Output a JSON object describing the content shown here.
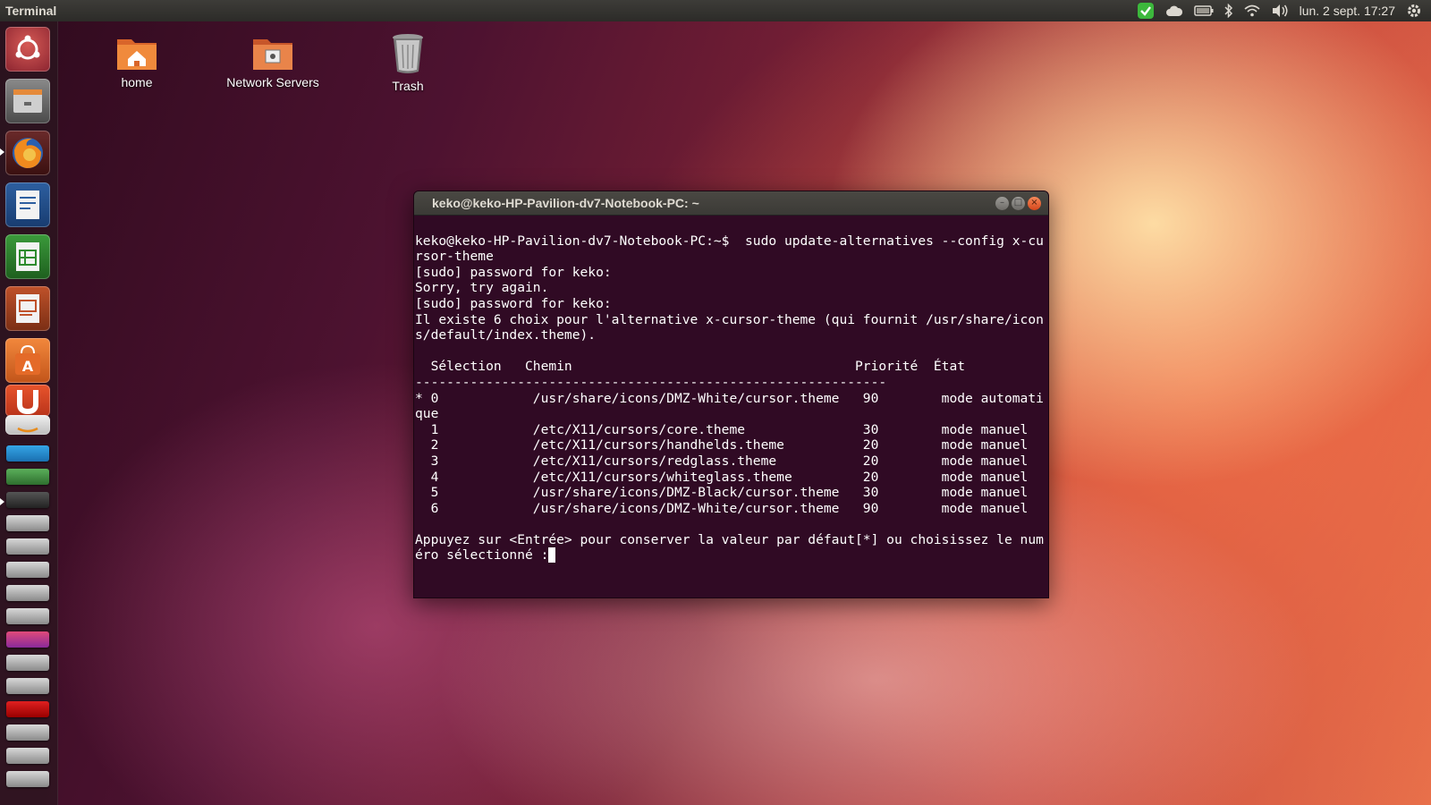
{
  "top_panel": {
    "app_title": "Terminal",
    "clock": "lun. 2 sept. 17:27",
    "indicators": [
      "update-check-icon",
      "cloud-icon",
      "battery-icon",
      "bluetooth-icon",
      "wifi-icon",
      "volume-icon",
      "gear-icon"
    ]
  },
  "desktop": {
    "icons": [
      {
        "label": "home"
      },
      {
        "label": "Network Servers"
      },
      {
        "label": "Trash"
      }
    ]
  },
  "launcher": {
    "items": [
      "ubuntu-dash-icon",
      "files-icon",
      "firefox-icon",
      "writer-icon",
      "calc-icon",
      "impress-icon",
      "software-center-icon",
      "ubuntu-one-icon",
      "amazon-icon"
    ]
  },
  "terminal": {
    "title": "keko@keko-HP-Pavilion-dv7-Notebook-PC: ~",
    "lines": [
      "keko@keko-HP-Pavilion-dv7-Notebook-PC:~$  sudo update-alternatives --config x-cu",
      "rsor-theme",
      "[sudo] password for keko:",
      "Sorry, try again.",
      "[sudo] password for keko:",
      "Il existe 6 choix pour l'alternative x-cursor-theme (qui fournit /usr/share/icon",
      "s/default/index.theme).",
      "",
      "  Sélection   Chemin                                    Priorité  État",
      "------------------------------------------------------------",
      "* 0            /usr/share/icons/DMZ-White/cursor.theme   90        mode automati",
      "que",
      "  1            /etc/X11/cursors/core.theme               30        mode manuel",
      "  2            /etc/X11/cursors/handhelds.theme          20        mode manuel",
      "  3            /etc/X11/cursors/redglass.theme           20        mode manuel",
      "  4            /etc/X11/cursors/whiteglass.theme         20        mode manuel",
      "  5            /usr/share/icons/DMZ-Black/cursor.theme   30        mode manuel",
      "  6            /usr/share/icons/DMZ-White/cursor.theme   90        mode manuel",
      "",
      "Appuyez sur <Entrée> pour conserver la valeur par défaut[*] ou choisissez le num"
    ],
    "prompt_line": "éro sélectionné :"
  }
}
